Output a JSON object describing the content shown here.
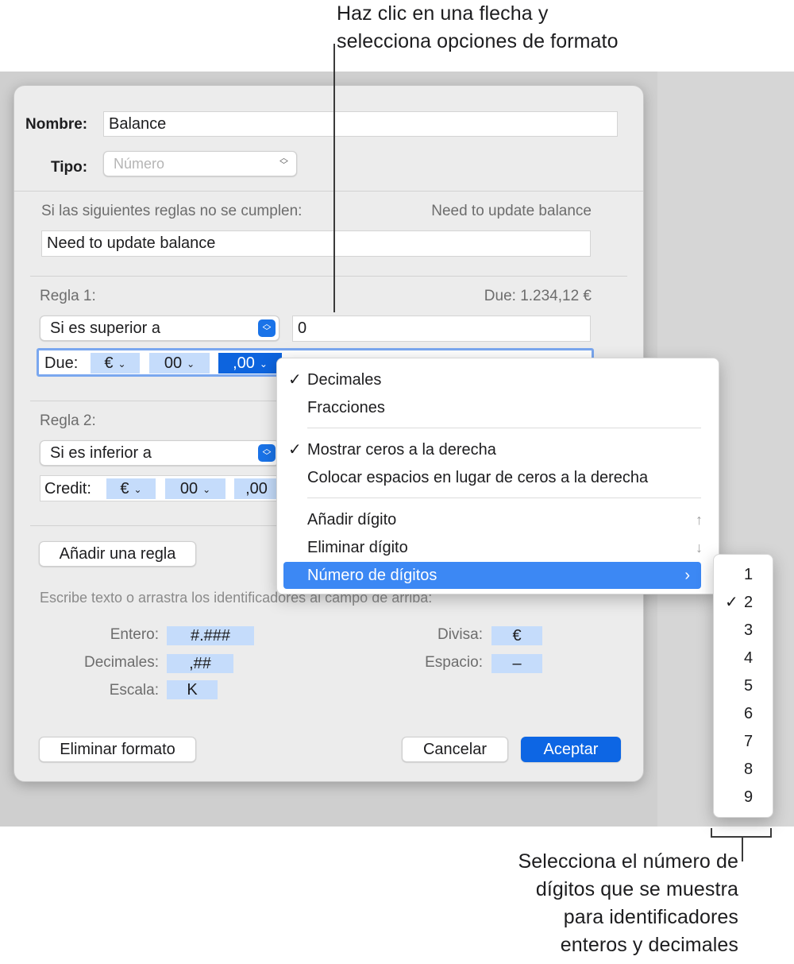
{
  "callouts": {
    "top": [
      "Haz clic en una flecha y",
      "selecciona opciones de formato"
    ],
    "bottom": [
      "Selecciona el número de",
      "dígitos que se muestra",
      "para identificadores",
      "enteros y decimales"
    ]
  },
  "dialog": {
    "name_label": "Nombre:",
    "name_value": "Balance",
    "type_label": "Tipo:",
    "type_value": "Número",
    "rules_intro": "Si las siguientes reglas no se cumplen:",
    "rules_preview": "Need to update balance",
    "rules_text": "Need to update balance",
    "rule1": {
      "title": "Regla 1:",
      "preview": "Due: 1.234,12 €",
      "condition": "Si es superior a",
      "value": "0",
      "prefix": "Due:",
      "tokens": [
        "€",
        "00",
        ",00"
      ]
    },
    "rule2": {
      "title": "Regla 2:",
      "condition": "Si es inferior a",
      "prefix": "Credit:",
      "tokens": [
        "€",
        "00",
        ",00"
      ]
    },
    "add_rule": "Añadir una regla",
    "help_text": "Escribe texto o arrastra los identificadores al campo de arriba:",
    "identifiers": {
      "integer_label": "Entero:",
      "integer_token": "#.###",
      "decimals_label": "Decimales:",
      "decimals_token": ",##",
      "scale_label": "Escala:",
      "scale_token": "K",
      "currency_label": "Divisa:",
      "currency_token": "€",
      "space_label": "Espacio:",
      "space_token": "–"
    },
    "delete_format": "Eliminar formato",
    "cancel": "Cancelar",
    "accept": "Aceptar"
  },
  "menu": {
    "items": [
      {
        "label": "Decimales",
        "checked": true
      },
      {
        "label": "Fracciones",
        "checked": false
      },
      {
        "label": "Mostrar ceros a la derecha",
        "checked": true
      },
      {
        "label": "Colocar espacios en lugar de ceros a la derecha",
        "checked": false
      },
      {
        "label": "Añadir dígito",
        "shortcut": "↑"
      },
      {
        "label": "Eliminar dígito",
        "shortcut": "↓"
      },
      {
        "label": "Número de dígitos",
        "submenu": "›"
      }
    ]
  },
  "submenu": {
    "items": [
      "1",
      "2",
      "3",
      "4",
      "5",
      "6",
      "7",
      "8",
      "9"
    ],
    "selected": "2"
  },
  "icons": {
    "check": "✓",
    "trash": "trash-icon",
    "chevron": "⌄",
    "stepper": "stepper-arrows-icon"
  }
}
